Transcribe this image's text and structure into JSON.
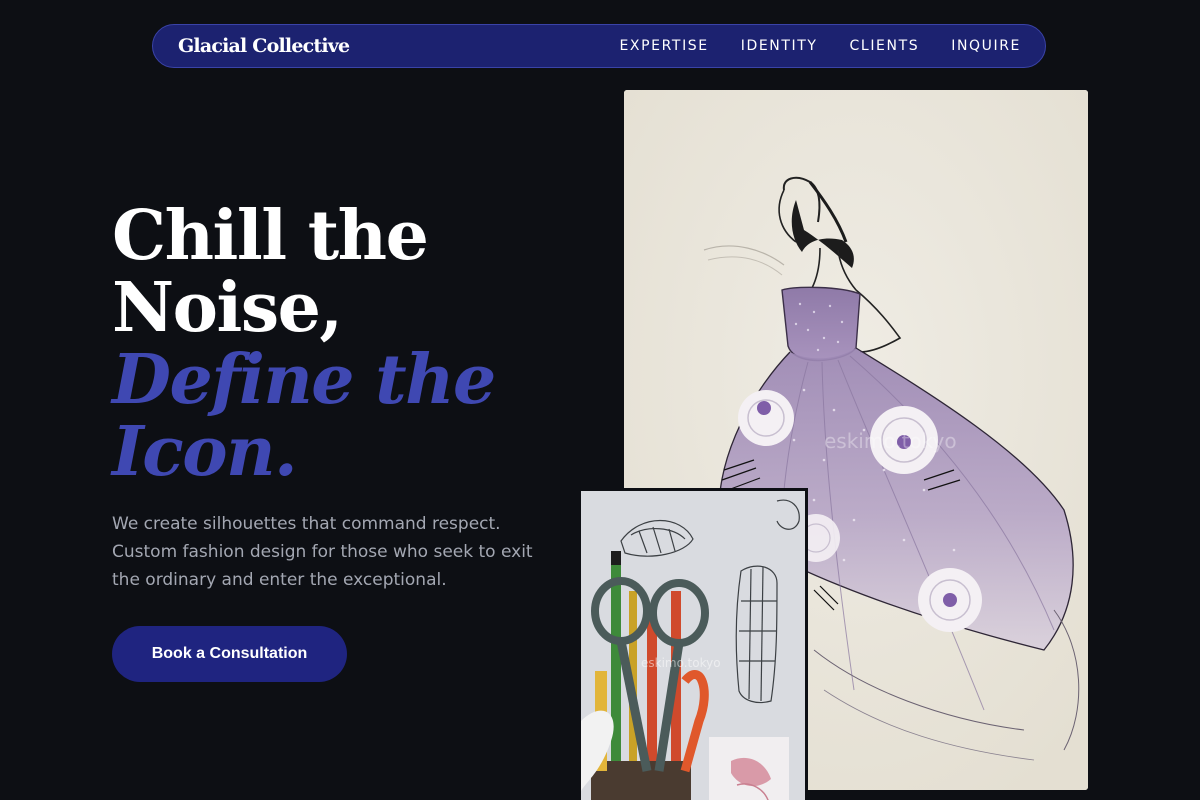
{
  "nav": {
    "brand": "Glacial Collective",
    "links": [
      "EXPERTISE",
      "IDENTITY",
      "CLIENTS",
      "INQUIRE"
    ]
  },
  "hero": {
    "headline_line1": "Chill the",
    "headline_line2": "Noise,",
    "headline_accent_line1": "Define the",
    "headline_accent_line2": "Icon.",
    "subtext": "We create silhouettes that command respect. Custom fashion design for those who seek to exit the ordinary and enter the exceptional.",
    "cta_label": "Book a Consultation"
  },
  "images": {
    "main_watermark": "eskimo.tokyo",
    "secondary_watermark": "eskimo.tokyo"
  },
  "colors": {
    "background": "#0d0f14",
    "nav_background": "#1c2270",
    "accent": "#3f48b2",
    "cta_background": "#1f2480",
    "subtext": "#a3a7b2"
  }
}
